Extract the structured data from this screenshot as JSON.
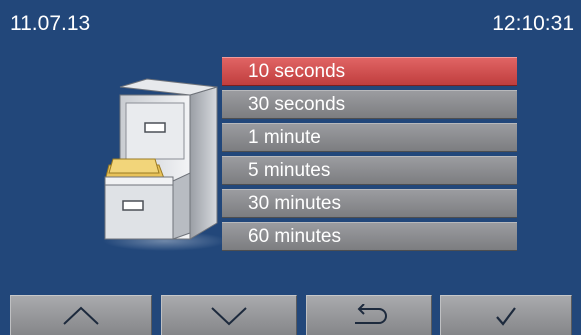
{
  "status": {
    "date": "11.07.13",
    "time": "12:10:31"
  },
  "illustration": {
    "icon": "file-cabinet-icon"
  },
  "options": [
    {
      "label": "10 seconds",
      "selected": true
    },
    {
      "label": "30 seconds",
      "selected": false
    },
    {
      "label": "1 minute",
      "selected": false
    },
    {
      "label": "5 minutes",
      "selected": false
    },
    {
      "label": "30 minutes",
      "selected": false
    },
    {
      "label": "60 minutes",
      "selected": false
    }
  ],
  "buttons": {
    "up": {
      "icon": "chevron-up-icon"
    },
    "down": {
      "icon": "chevron-down-icon"
    },
    "back": {
      "icon": "return-arrow-icon"
    },
    "ok": {
      "icon": "checkmark-icon"
    }
  },
  "colors": {
    "background": "#22477a",
    "selected": "#d04e4e",
    "item": "#8a8b8e"
  }
}
